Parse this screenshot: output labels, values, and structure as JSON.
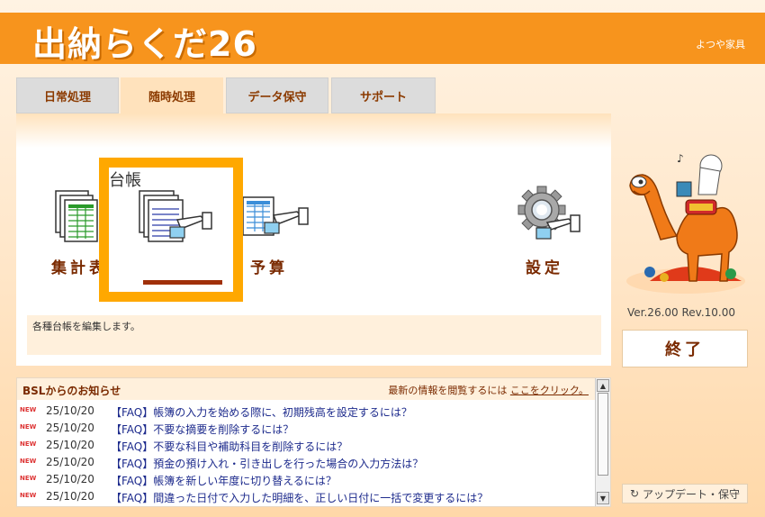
{
  "header": {
    "logo": "出納らくだ26",
    "company": "よつや家具"
  },
  "tabs": [
    {
      "label": "日常処理",
      "active": false
    },
    {
      "label": "随時処理",
      "active": true
    },
    {
      "label": "データ保守",
      "active": false
    },
    {
      "label": "サポート",
      "active": false
    }
  ],
  "features": {
    "summary": "集計表",
    "ledger": "台帳",
    "budget": "予算",
    "settings": "設定"
  },
  "description": "各種台帳を編集します。",
  "sidebar": {
    "version": "Ver.26.00 Rev.10.00",
    "exit_label": "終了",
    "update_label": "アップデート・保守"
  },
  "news": {
    "title": "BSLからのお知らせ",
    "hint_prefix": "最新の情報を閲覧するには",
    "hint_link": "ここをクリック。",
    "items": [
      {
        "badge": "NEW",
        "date": "25/10/20",
        "text": "【FAQ】帳簿の入力を始める際に、初期残高を設定するには？"
      },
      {
        "badge": "NEW",
        "date": "25/10/20",
        "text": "【FAQ】不要な摘要を削除するには？"
      },
      {
        "badge": "NEW",
        "date": "25/10/20",
        "text": "【FAQ】不要な科目や補助科目を削除するには？"
      },
      {
        "badge": "NEW",
        "date": "25/10/20",
        "text": "【FAQ】預金の預け入れ・引き出しを行った場合の入力方法は？"
      },
      {
        "badge": "NEW",
        "date": "25/10/20",
        "text": "【FAQ】帳簿を新しい年度に切り替えるには？"
      },
      {
        "badge": "NEW",
        "date": "25/10/20",
        "text": "【FAQ】間違った日付で入力した明細を、正しい日付に一括で変更するには？"
      }
    ]
  },
  "colors": {
    "brand_orange": "#f7941d",
    "selection": "#ffa800",
    "label_brown": "#7a2a00",
    "link_blue": "#1c2a8c"
  }
}
